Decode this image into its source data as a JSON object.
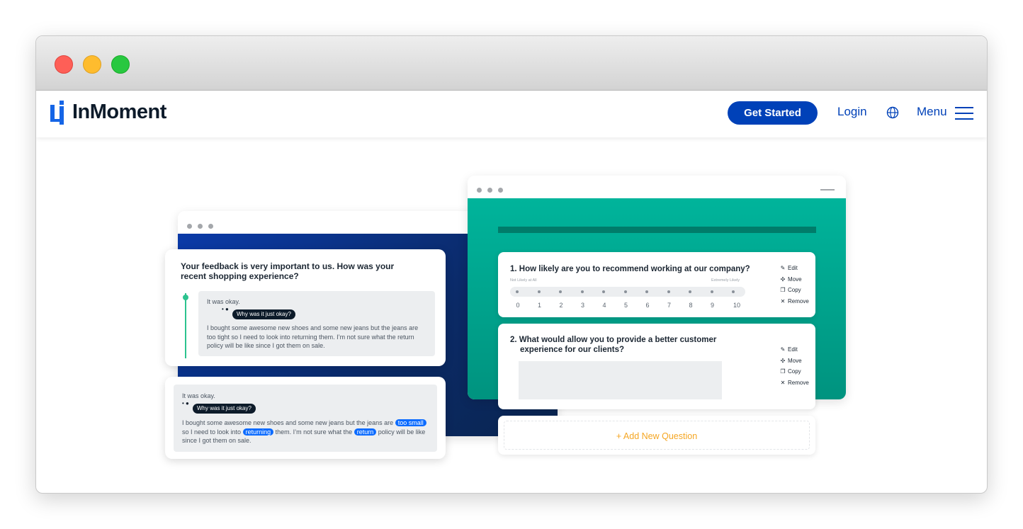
{
  "window": {
    "controls": [
      "close",
      "minimize",
      "maximize"
    ]
  },
  "navbar": {
    "brand": "InMoment",
    "cta_label": "Get Started",
    "login_label": "Login",
    "menu_label": "Menu",
    "colors": {
      "brand_blue": "#0041b8",
      "logo_blue": "#1565e6"
    }
  },
  "feedback_card": {
    "question": "Your feedback is very important to us. How was your recent shopping experience?",
    "reply_short": "It was okay.",
    "followup_pill": "Why was it just okay?",
    "reply_long": "I bought some awesome new shoes and some new jeans but the jeans are too tight so I need to look into returning them. I’m not sure what the return policy will be like since I got them on sale."
  },
  "analysis_card": {
    "reply_short": "It was okay.",
    "followup_pill": "Why was it just okay?",
    "text_1": "I bought some awesome new shoes and some new jeans but the jeans are",
    "highlight_1": "too small",
    "text_2": "so I need to look into",
    "highlight_2": "returning",
    "text_3": "them. I’m not sure what the",
    "highlight_3": "return",
    "text_4": "policy will be like since I got them on sale."
  },
  "survey_builder": {
    "q1": {
      "title": "1. How likely are you to recommend working at our company?",
      "low_label": "Not Likely at All",
      "high_label": "Extremely Likely",
      "scale": [
        "0",
        "1",
        "2",
        "3",
        "4",
        "5",
        "6",
        "7",
        "8",
        "9",
        "10"
      ]
    },
    "q2": {
      "title_line1": "2. What would allow you to provide a better customer",
      "title_line2": "experience for our clients?"
    },
    "actions": [
      {
        "icon": "pencil-icon",
        "label": "Edit"
      },
      {
        "icon": "move-icon",
        "label": "Move"
      },
      {
        "icon": "copy-icon",
        "label": "Copy"
      },
      {
        "icon": "close-icon",
        "label": "Remove"
      }
    ],
    "add_question_label": "+ Add New Question"
  }
}
